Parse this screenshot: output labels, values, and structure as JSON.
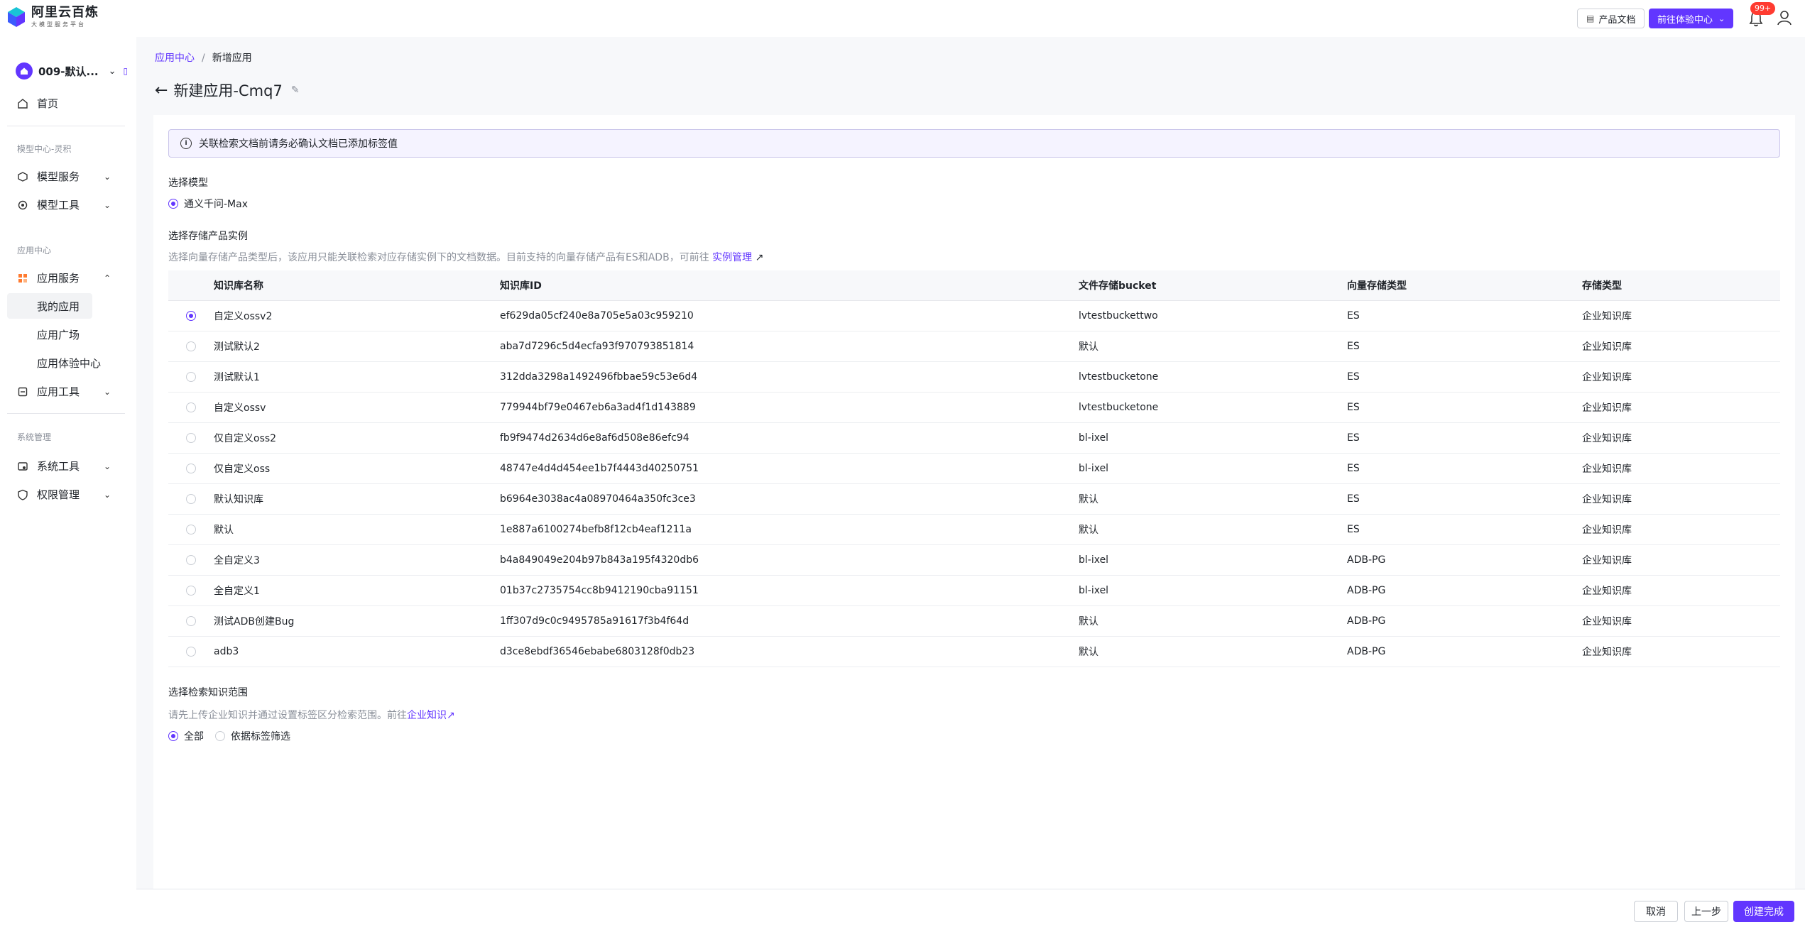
{
  "brand": {
    "title": "阿里云百炼",
    "subtitle": "大模型服务平台"
  },
  "header": {
    "doc_btn": "产品文档",
    "experience_btn": "前往体验中心",
    "badge": "99+"
  },
  "sidebar": {
    "workspace": "009-默认...",
    "home": "首页",
    "section_model": "模型中心-灵积",
    "model_service": "模型服务",
    "model_tools": "模型工具",
    "section_app": "应用中心",
    "app_service": "应用服务",
    "my_apps": "我的应用",
    "app_square": "应用广场",
    "app_experience": "应用体验中心",
    "app_tools": "应用工具",
    "section_sys": "系统管理",
    "sys_tools": "系统工具",
    "perm": "权限管理"
  },
  "breadcrumb": {
    "parent": "应用中心",
    "sep": "/",
    "current": "新增应用"
  },
  "page": {
    "title": "新建应用-Cmq7"
  },
  "notice": "关联检索文档前请务必确认文档已添加标签值",
  "model": {
    "title": "选择模型",
    "option": "通义千问-Max"
  },
  "storage": {
    "title": "选择存储产品实例",
    "hint": "选择向量存储产品类型后，该应用只能关联检索对应存储实例下的文档数据。目前支持的向量存储产品有ES和ADB，可前往",
    "link": "实例管理"
  },
  "table": {
    "headers": [
      "知识库名称",
      "知识库ID",
      "文件存储bucket",
      "向量存储类型",
      "存储类型"
    ],
    "rows": [
      {
        "name": "自定义ossv2",
        "id": "ef629da05cf240e8a705e5a03c959210",
        "bucket": "lvtestbuckettwo",
        "vec": "ES",
        "type": "企业知识库"
      },
      {
        "name": "测试默认2",
        "id": "aba7d7296c5d4ecfa93f970793851814",
        "bucket": "默认",
        "vec": "ES",
        "type": "企业知识库"
      },
      {
        "name": "测试默认1",
        "id": "312dda3298a1492496fbbae59c53e6d4",
        "bucket": "lvtestbucketone",
        "vec": "ES",
        "type": "企业知识库"
      },
      {
        "name": "自定义ossv",
        "id": "779944bf79e0467eb6a3ad4f1d143889",
        "bucket": "lvtestbucketone",
        "vec": "ES",
        "type": "企业知识库"
      },
      {
        "name": "仅自定义oss2",
        "id": "fb9f9474d2634d6e8af6d508e86efc94",
        "bucket": "bl-ixel",
        "vec": "ES",
        "type": "企业知识库"
      },
      {
        "name": "仅自定义oss",
        "id": "48747e4d4d454ee1b7f4443d40250751",
        "bucket": "bl-ixel",
        "vec": "ES",
        "type": "企业知识库"
      },
      {
        "name": "默认知识库",
        "id": "b6964e3038ac4a08970464a350fc3ce3",
        "bucket": "默认",
        "vec": "ES",
        "type": "企业知识库"
      },
      {
        "name": "默认",
        "id": "1e887a6100274befb8f12cb4eaf1211a",
        "bucket": "默认",
        "vec": "ES",
        "type": "企业知识库"
      },
      {
        "name": "全自定义3",
        "id": "b4a849049e204b97b843a195f4320db6",
        "bucket": "bl-ixel",
        "vec": "ADB-PG",
        "type": "企业知识库"
      },
      {
        "name": "全自定义1",
        "id": "01b37c2735754cc8b9412190cba91151",
        "bucket": "bl-ixel",
        "vec": "ADB-PG",
        "type": "企业知识库"
      },
      {
        "name": "测试ADB创建Bug",
        "id": "1ff307d9c0c9495785a91617f3b4f64d",
        "bucket": "默认",
        "vec": "ADB-PG",
        "type": "企业知识库"
      },
      {
        "name": "adb3",
        "id": "d3ce8ebdf36546ebabe6803128f0db23",
        "bucket": "默认",
        "vec": "ADB-PG",
        "type": "企业知识库"
      }
    ]
  },
  "scope": {
    "title": "选择检索知识范围",
    "hint": "请先上传企业知识并通过设置标签区分检索范围。前往",
    "link": "企业知识",
    "opt_all": "全部",
    "opt_tag": "依据标签筛选"
  },
  "footer": {
    "cancel": "取消",
    "prev": "上一步",
    "finish": "创建完成"
  },
  "colors": {
    "primary": "#6236ff",
    "badge": "#ff3b30"
  }
}
